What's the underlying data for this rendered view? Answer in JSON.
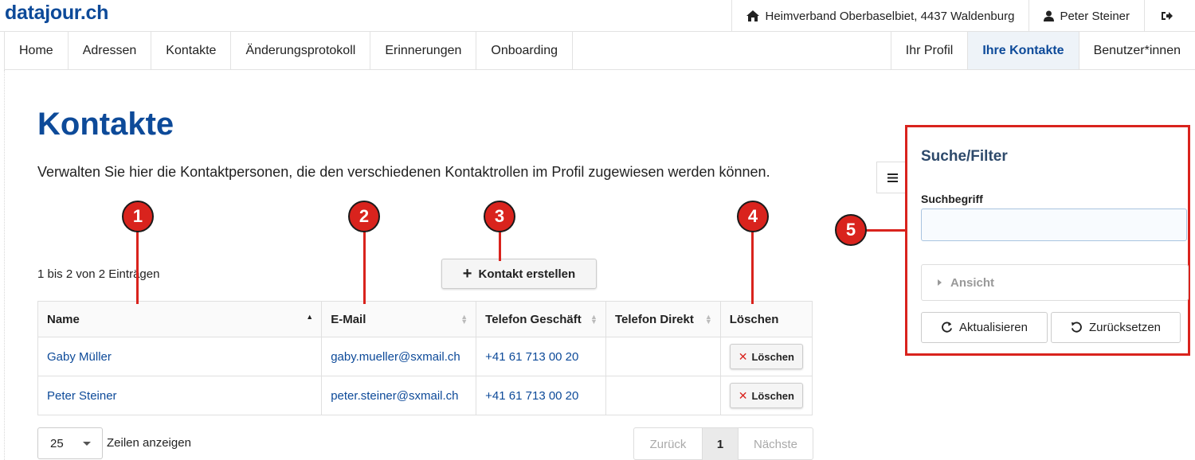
{
  "header": {
    "logo": "datajour.ch",
    "organization": "Heimverband Oberbaselbiet, 4437 Waldenburg",
    "user": "Peter Steiner"
  },
  "nav": {
    "left": [
      "Home",
      "Adressen",
      "Kontakte",
      "Änderungsprotokoll",
      "Erinnerungen",
      "Onboarding"
    ],
    "right": [
      "Ihr Profil",
      "Ihre Kontakte",
      "Benutzer*innen"
    ],
    "active": "Ihre Kontakte"
  },
  "page": {
    "title": "Kontakte",
    "description": "Verwalten Sie hier die Kontaktpersonen, die den verschiedenen Kontaktrollen im Profil zugewiesen werden können.",
    "entries_info": "1 bis 2 von 2 Einträgen",
    "create_button": "Kontakt erstellen"
  },
  "table": {
    "headers": [
      "Name",
      "E-Mail",
      "Telefon Geschäft",
      "Telefon Direkt",
      "Löschen"
    ],
    "rows": [
      {
        "name": "Gaby Müller",
        "email": "gaby.mueller@sxmail.ch",
        "phone_business": "+41 61 713 00 20",
        "phone_direct": "",
        "delete": "Löschen"
      },
      {
        "name": "Peter Steiner",
        "email": "peter.steiner@sxmail.ch",
        "phone_business": "+41 61 713 00 20",
        "phone_direct": "",
        "delete": "Löschen"
      }
    ]
  },
  "footer": {
    "rows_per_page": "25",
    "rows_label": "Zeilen anzeigen",
    "prev": "Zurück",
    "current_page": "1",
    "next": "Nächste"
  },
  "filter": {
    "title": "Suche/Filter",
    "search_label": "Suchbegriff",
    "search_value": "",
    "view_label": "Ansicht",
    "refresh_button": "Aktualisieren",
    "reset_button": "Zurücksetzen"
  },
  "annotations": [
    "1",
    "2",
    "3",
    "4",
    "5"
  ],
  "colors": {
    "brand": "#0d4a99",
    "annotation": "#d9231d",
    "active_nav_bg": "#eef3f8"
  }
}
